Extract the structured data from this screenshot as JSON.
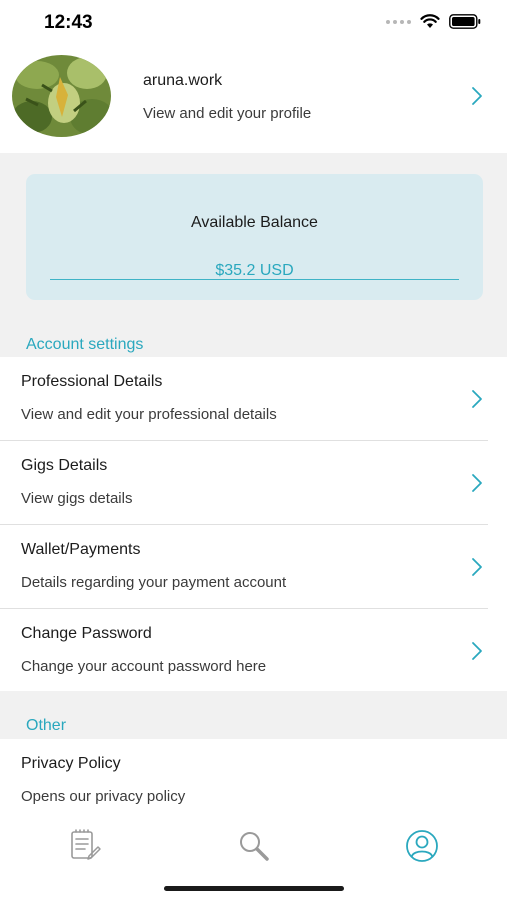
{
  "status_bar": {
    "time": "12:43"
  },
  "profile": {
    "name": "aruna.work",
    "subtitle": "View and edit your profile"
  },
  "balance": {
    "title": "Available Balance",
    "amount": "$35.2 USD"
  },
  "sections": {
    "account_settings": "Account settings",
    "other": "Other"
  },
  "account_items": [
    {
      "title": "Professional Details",
      "subtitle": "View and edit your professional details"
    },
    {
      "title": "Gigs Details",
      "subtitle": "View gigs details"
    },
    {
      "title": "Wallet/Payments",
      "subtitle": "Details regarding your payment account"
    },
    {
      "title": "Change Password",
      "subtitle": "Change your account password here"
    }
  ],
  "other_items": [
    {
      "title": "Privacy Policy",
      "subtitle": "Opens our privacy policy"
    }
  ],
  "tab_bar": {
    "tabs": [
      {
        "icon": "gigs-list-icon",
        "active": false
      },
      {
        "icon": "search-icon",
        "active": false
      },
      {
        "icon": "profile-icon",
        "active": true
      }
    ]
  },
  "colors": {
    "accent": "#2aa8be",
    "balance_card": "#d9ebf0",
    "section_bg": "#f1f1f1",
    "inactive_icon": "#9a9a9a"
  }
}
